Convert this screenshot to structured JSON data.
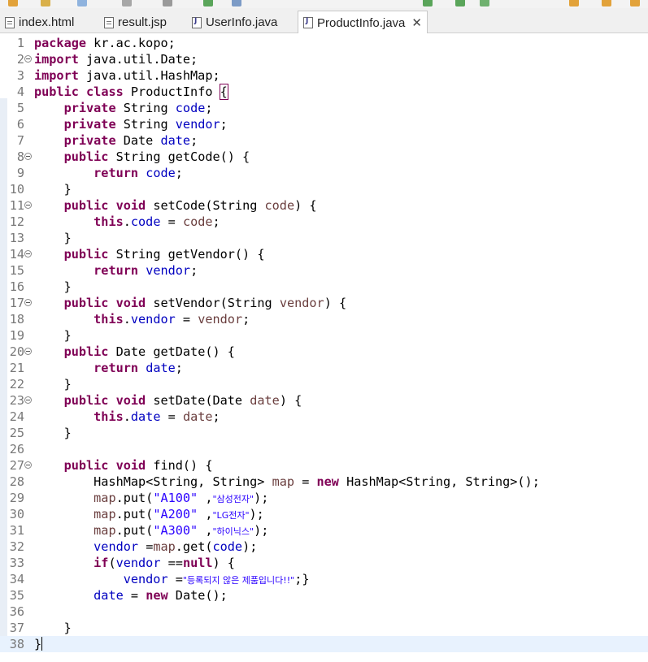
{
  "tabs": [
    {
      "label": "index.html",
      "active": false,
      "closable": false,
      "icon": "html-file-icon"
    },
    {
      "label": "result.jsp",
      "active": false,
      "closable": false,
      "icon": "jsp-file-icon"
    },
    {
      "label": "UserInfo.java",
      "active": false,
      "closable": false,
      "icon": "java-file-icon"
    },
    {
      "label": "ProductInfo.java",
      "active": true,
      "closable": true,
      "icon": "java-file-icon"
    }
  ],
  "editor": {
    "current_line": 38,
    "lines": [
      {
        "n": "1",
        "fold": false,
        "segs": [
          [
            "kw",
            "package"
          ],
          [
            "",
            "kr.ac.kopo;"
          ]
        ]
      },
      {
        "n": "2",
        "fold": true,
        "segs": [
          [
            "kw",
            "import"
          ],
          [
            "",
            "java.util.Date;"
          ]
        ]
      },
      {
        "n": "3",
        "fold": false,
        "segs": [
          [
            "kw",
            "import"
          ],
          [
            "",
            "java.util.HashMap;"
          ]
        ]
      },
      {
        "n": "4",
        "fold": false,
        "segs": [
          [
            "kw",
            "public"
          ],
          [
            "kw",
            "class"
          ],
          [
            "",
            "ProductInfo"
          ],
          [
            "box",
            "{"
          ]
        ]
      },
      {
        "n": "5",
        "fold": false,
        "segs": [
          [
            "",
            "    "
          ],
          [
            "kw",
            "private"
          ],
          [
            "",
            "String"
          ],
          [
            "fld",
            "code"
          ],
          [
            "",
            ";"
          ]
        ]
      },
      {
        "n": "6",
        "fold": false,
        "segs": [
          [
            "",
            "    "
          ],
          [
            "kw",
            "private"
          ],
          [
            "",
            "String"
          ],
          [
            "fld",
            "vendor"
          ],
          [
            "",
            ";"
          ]
        ]
      },
      {
        "n": "7",
        "fold": false,
        "segs": [
          [
            "",
            "    "
          ],
          [
            "kw",
            "private"
          ],
          [
            "",
            "Date"
          ],
          [
            "fld",
            "date"
          ],
          [
            "",
            ";"
          ]
        ]
      },
      {
        "n": "8",
        "fold": true,
        "segs": [
          [
            "",
            "    "
          ],
          [
            "kw",
            "public"
          ],
          [
            "",
            "String getCode() {"
          ]
        ]
      },
      {
        "n": "9",
        "fold": false,
        "segs": [
          [
            "",
            "        "
          ],
          [
            "kw",
            "return"
          ],
          [
            "fld",
            "code"
          ],
          [
            "",
            ";"
          ]
        ]
      },
      {
        "n": "10",
        "fold": false,
        "segs": [
          [
            "",
            "    }"
          ]
        ]
      },
      {
        "n": "11",
        "fold": true,
        "segs": [
          [
            "",
            "    "
          ],
          [
            "kw",
            "public"
          ],
          [
            "kw",
            "void"
          ],
          [
            "",
            "setCode(String"
          ],
          [
            "prm",
            "code"
          ],
          [
            "",
            ") {"
          ]
        ]
      },
      {
        "n": "12",
        "fold": false,
        "segs": [
          [
            "",
            "        "
          ],
          [
            "kw",
            "this"
          ],
          [
            "",
            ".",
            0
          ],
          [
            "fld",
            "code",
            0
          ],
          [
            "",
            "="
          ],
          [
            "prm",
            "code"
          ],
          [
            "",
            ";"
          ]
        ]
      },
      {
        "n": "13",
        "fold": false,
        "segs": [
          [
            "",
            "    }"
          ]
        ]
      },
      {
        "n": "14",
        "fold": true,
        "segs": [
          [
            "",
            "    "
          ],
          [
            "kw",
            "public"
          ],
          [
            "",
            "String getVendor() {"
          ]
        ]
      },
      {
        "n": "15",
        "fold": false,
        "segs": [
          [
            "",
            "        "
          ],
          [
            "kw",
            "return"
          ],
          [
            "fld",
            "vendor"
          ],
          [
            "",
            ";"
          ]
        ]
      },
      {
        "n": "16",
        "fold": false,
        "segs": [
          [
            "",
            "    }"
          ]
        ]
      },
      {
        "n": "17",
        "fold": true,
        "segs": [
          [
            "",
            "    "
          ],
          [
            "kw",
            "public"
          ],
          [
            "kw",
            "void"
          ],
          [
            "",
            "setVendor(String"
          ],
          [
            "prm",
            "vendor"
          ],
          [
            "",
            ") {"
          ]
        ]
      },
      {
        "n": "18",
        "fold": false,
        "segs": [
          [
            "",
            "        "
          ],
          [
            "kw",
            "this"
          ],
          [
            "",
            ".",
            0
          ],
          [
            "fld",
            "vendor",
            0
          ],
          [
            "",
            "="
          ],
          [
            "prm",
            "vendor"
          ],
          [
            "",
            ";"
          ]
        ]
      },
      {
        "n": "19",
        "fold": false,
        "segs": [
          [
            "",
            "    }"
          ]
        ]
      },
      {
        "n": "20",
        "fold": true,
        "segs": [
          [
            "",
            "    "
          ],
          [
            "kw",
            "public"
          ],
          [
            "",
            "Date getDate() {"
          ]
        ]
      },
      {
        "n": "21",
        "fold": false,
        "segs": [
          [
            "",
            "        "
          ],
          [
            "kw",
            "return"
          ],
          [
            "fld",
            "date"
          ],
          [
            "",
            ";"
          ]
        ]
      },
      {
        "n": "22",
        "fold": false,
        "segs": [
          [
            "",
            "    }"
          ]
        ]
      },
      {
        "n": "23",
        "fold": true,
        "segs": [
          [
            "",
            "    "
          ],
          [
            "kw",
            "public"
          ],
          [
            "kw",
            "void"
          ],
          [
            "",
            "setDate(Date"
          ],
          [
            "prm",
            "date"
          ],
          [
            "",
            ") {"
          ]
        ]
      },
      {
        "n": "24",
        "fold": false,
        "segs": [
          [
            "",
            "        "
          ],
          [
            "kw",
            "this"
          ],
          [
            "",
            ".",
            0
          ],
          [
            "fld",
            "date",
            0
          ],
          [
            "",
            "="
          ],
          [
            "prm",
            "date"
          ],
          [
            "",
            ";"
          ]
        ]
      },
      {
        "n": "25",
        "fold": false,
        "segs": [
          [
            "",
            "    }"
          ]
        ]
      },
      {
        "n": "26",
        "fold": false,
        "segs": []
      },
      {
        "n": "27",
        "fold": true,
        "segs": [
          [
            "",
            "    "
          ],
          [
            "kw",
            "public"
          ],
          [
            "kw",
            "void"
          ],
          [
            "",
            "find() {"
          ]
        ]
      },
      {
        "n": "28",
        "fold": false,
        "segs": [
          [
            "",
            "        HashMap<String, String>"
          ],
          [
            "prm",
            "map"
          ],
          [
            "",
            "="
          ],
          [
            "kw",
            "new"
          ],
          [
            "",
            "HashMap<String, String>();"
          ]
        ]
      },
      {
        "n": "29",
        "fold": false,
        "segs": [
          [
            "",
            "        "
          ],
          [
            "prm",
            "map",
            0
          ],
          [
            "",
            ".put(",
            0
          ],
          [
            "str",
            "\"A100\"",
            0
          ],
          [
            "",
            ","
          ],
          [
            "str",
            "\"삼성전자\"",
            0,
            1
          ],
          [
            "",
            ");",
            0
          ]
        ]
      },
      {
        "n": "30",
        "fold": false,
        "segs": [
          [
            "",
            "        "
          ],
          [
            "prm",
            "map",
            0
          ],
          [
            "",
            ".put(",
            0
          ],
          [
            "str",
            "\"A200\"",
            0
          ],
          [
            "",
            ","
          ],
          [
            "str",
            "\"LG전자\"",
            0,
            1
          ],
          [
            "",
            ");",
            0
          ]
        ]
      },
      {
        "n": "31",
        "fold": false,
        "segs": [
          [
            "",
            "        "
          ],
          [
            "prm",
            "map",
            0
          ],
          [
            "",
            ".put(",
            0
          ],
          [
            "str",
            "\"A300\"",
            0
          ],
          [
            "",
            ","
          ],
          [
            "str",
            "\"하이닉스\"",
            0,
            1
          ],
          [
            "",
            ");",
            0
          ]
        ]
      },
      {
        "n": "32",
        "fold": false,
        "segs": [
          [
            "",
            "        "
          ],
          [
            "fld",
            "vendor"
          ],
          [
            "",
            "="
          ],
          [
            "prm",
            "map",
            0
          ],
          [
            "",
            ".get(",
            0
          ],
          [
            "fld",
            "code",
            0
          ],
          [
            "",
            ");",
            0
          ]
        ]
      },
      {
        "n": "33",
        "fold": false,
        "segs": [
          [
            "",
            "        "
          ],
          [
            "kw",
            "if",
            0
          ],
          [
            "",
            "(",
            0
          ],
          [
            "fld",
            "vendor",
            0
          ],
          [
            "",
            "=="
          ],
          [
            "kw",
            "null",
            0
          ],
          [
            "",
            ") {"
          ]
        ]
      },
      {
        "n": "34",
        "fold": false,
        "segs": [
          [
            "",
            "            "
          ],
          [
            "fld",
            "vendor"
          ],
          [
            "",
            "="
          ],
          [
            "str",
            "\"등록되지 않은 제품입니다!!\"",
            0,
            1
          ],
          [
            "",
            ";}",
            0
          ]
        ]
      },
      {
        "n": "35",
        "fold": false,
        "segs": [
          [
            "",
            "        "
          ],
          [
            "fld",
            "date"
          ],
          [
            "",
            "="
          ],
          [
            "kw",
            "new"
          ],
          [
            "",
            "Date();"
          ]
        ]
      },
      {
        "n": "36",
        "fold": false,
        "segs": []
      },
      {
        "n": "37",
        "fold": false,
        "segs": [
          [
            "",
            "    }"
          ]
        ]
      },
      {
        "n": "38",
        "fold": false,
        "segs": [
          [
            "",
            "}"
          ],
          [
            "cursor",
            ""
          ]
        ]
      }
    ]
  }
}
